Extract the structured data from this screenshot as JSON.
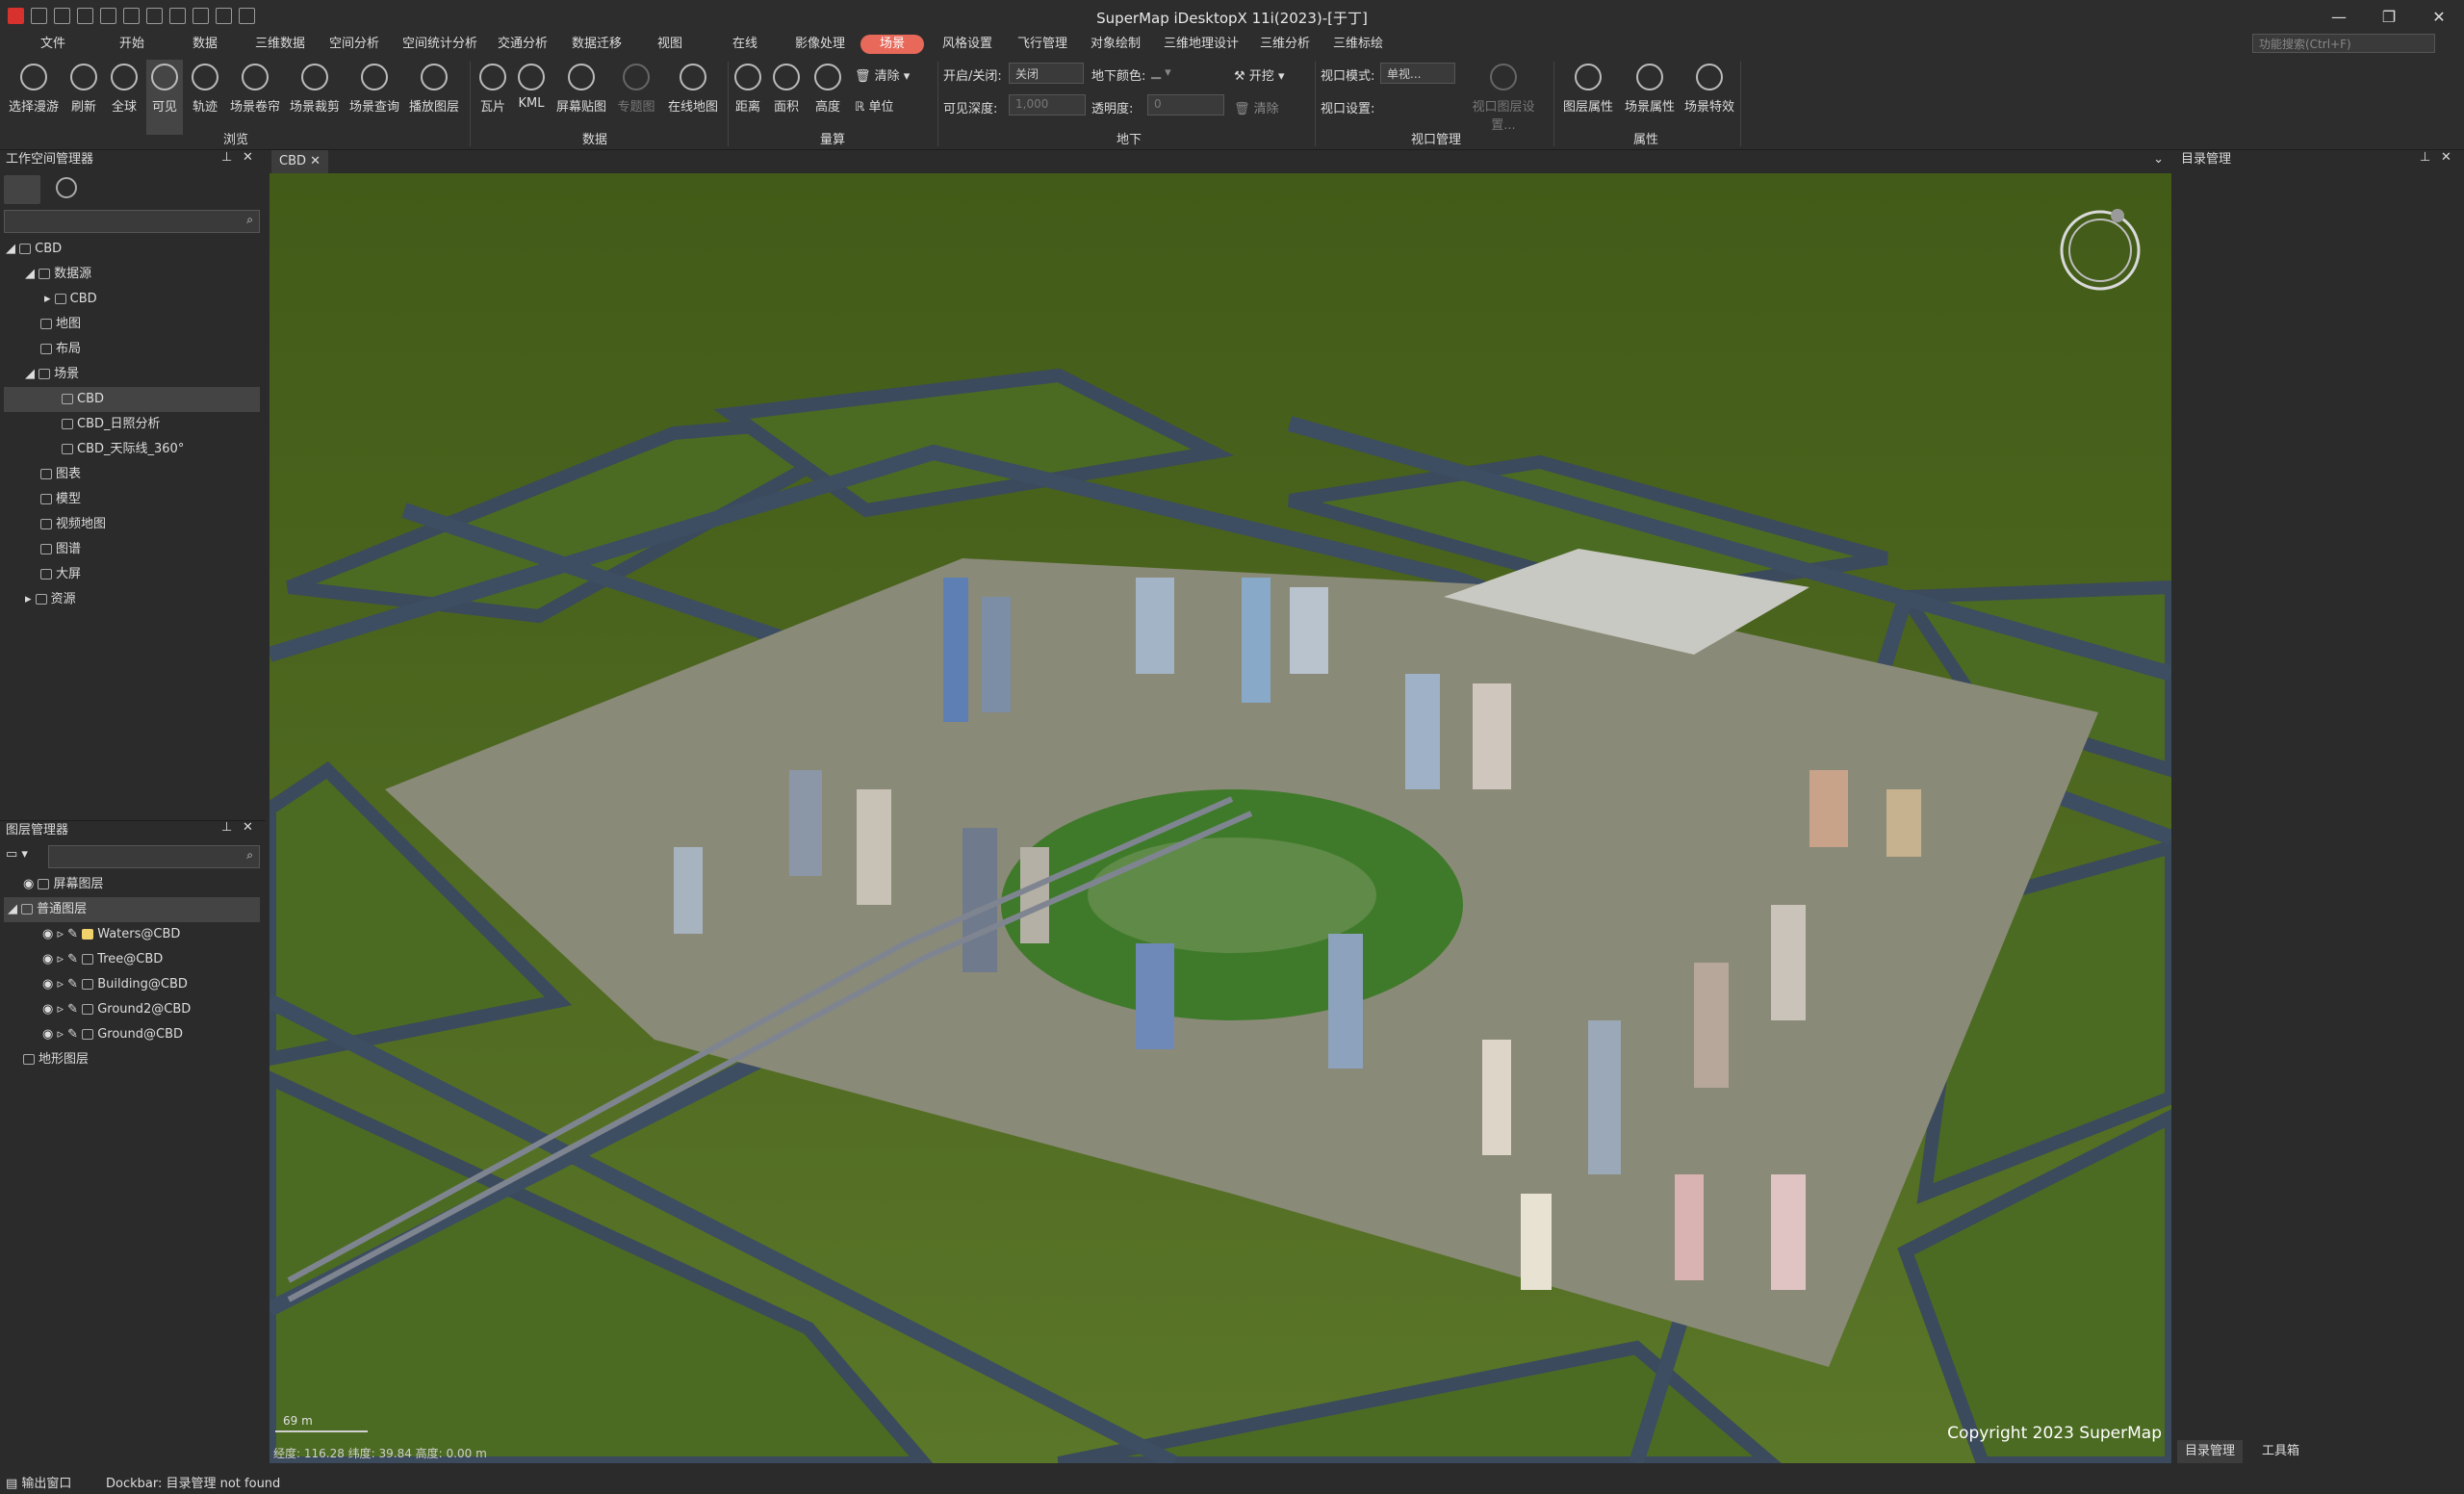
{
  "window": {
    "title": "SuperMap iDesktopX 11i(2023)-[于丁]",
    "minimize_icon": "minimize-icon",
    "restore_icon": "restore-icon",
    "close_icon": "close-icon"
  },
  "menu": {
    "items": [
      "文件",
      "开始",
      "数据",
      "三维数据",
      "空间分析",
      "空间统计分析",
      "交通分析",
      "数据迁移",
      "视图",
      "在线",
      "影像处理",
      "场景",
      "风格设置",
      "飞行管理",
      "对象绘制",
      "三维地理设计",
      "三维分析",
      "三维标绘"
    ],
    "active": "场景",
    "search_placeholder": "功能搜索(Ctrl+F)"
  },
  "ribbon": {
    "browse": {
      "label": "浏览",
      "buttons": [
        "选择漫游",
        "刷新",
        "全球",
        "可见",
        "轨迹",
        "场景卷帘",
        "场景裁剪",
        "场景查询",
        "播放图层"
      ]
    },
    "data": {
      "label": "数据",
      "buttons": [
        "瓦片",
        "KML",
        "屏幕贴图",
        "专题图",
        "在线地图"
      ]
    },
    "measure": {
      "label": "量算",
      "buttons": [
        "距离",
        "面积",
        "高度"
      ],
      "clear": "清除",
      "unit": "单位"
    },
    "underground": {
      "label": "地下",
      "toggle_label": "开启/关闭:",
      "toggle_value": "关闭",
      "color_label": "地下颜色:",
      "excavate": "开挖",
      "depth_label": "可见深度:",
      "depth_value": "1,000",
      "opacity_label": "透明度:",
      "opacity_value": "0",
      "clear": "清除"
    },
    "viewport": {
      "label": "视口管理",
      "mode_label": "视口模式:",
      "mode_value": "单视...",
      "settings_label": "视口设置:",
      "settings_button": "视口图层设置..."
    },
    "properties": {
      "label": "属性",
      "buttons": [
        "图层属性",
        "场景属性",
        "场景特效"
      ]
    }
  },
  "workspace": {
    "title": "工作空间管理器",
    "items": [
      {
        "label": "CBD",
        "icon": "workspace-icon"
      },
      {
        "label": "数据源",
        "icon": "datasource-icon"
      },
      {
        "label": "CBD",
        "icon": "database-icon"
      },
      {
        "label": "地图",
        "icon": "map-icon"
      },
      {
        "label": "布局",
        "icon": "layout-icon"
      },
      {
        "label": "场景",
        "icon": "scene-icon"
      },
      {
        "label": "CBD",
        "icon": "scene-item-icon"
      },
      {
        "label": "CBD_日照分析",
        "icon": "scene-item-icon"
      },
      {
        "label": "CBD_天际线_360°",
        "icon": "scene-item-icon"
      },
      {
        "label": "图表",
        "icon": "chart-icon"
      },
      {
        "label": "模型",
        "icon": "model-icon"
      },
      {
        "label": "视频地图",
        "icon": "video-map-icon"
      },
      {
        "label": "图谱",
        "icon": "graph-icon"
      },
      {
        "label": "大屏",
        "icon": "screen-icon"
      },
      {
        "label": "资源",
        "icon": "folder-icon"
      }
    ]
  },
  "layers": {
    "title": "图层管理器",
    "items": [
      {
        "label": "屏幕图层"
      },
      {
        "label": "普通图层"
      },
      {
        "label": "Waters@CBD"
      },
      {
        "label": "Tree@CBD"
      },
      {
        "label": "Building@CBD"
      },
      {
        "label": "Ground2@CBD"
      },
      {
        "label": "Ground@CBD"
      },
      {
        "label": "地形图层"
      }
    ]
  },
  "scene": {
    "tab_label": "CBD",
    "copyright": "Copyright 2023 SuperMap",
    "scale": "69 m",
    "coords": "经度: 116.28  纬度: 39.84  高度: 0.00 m"
  },
  "catalog": {
    "title": "目录管理",
    "tabs": [
      "目录管理",
      "工具箱"
    ]
  },
  "status": {
    "output_label": "输出窗口",
    "message": "Dockbar: 目录管理 not found"
  },
  "colors": {
    "accent": "#e8695a",
    "ground": "#4f6a22",
    "road": "#3b4a5c",
    "panel": "#2b2b2b"
  }
}
